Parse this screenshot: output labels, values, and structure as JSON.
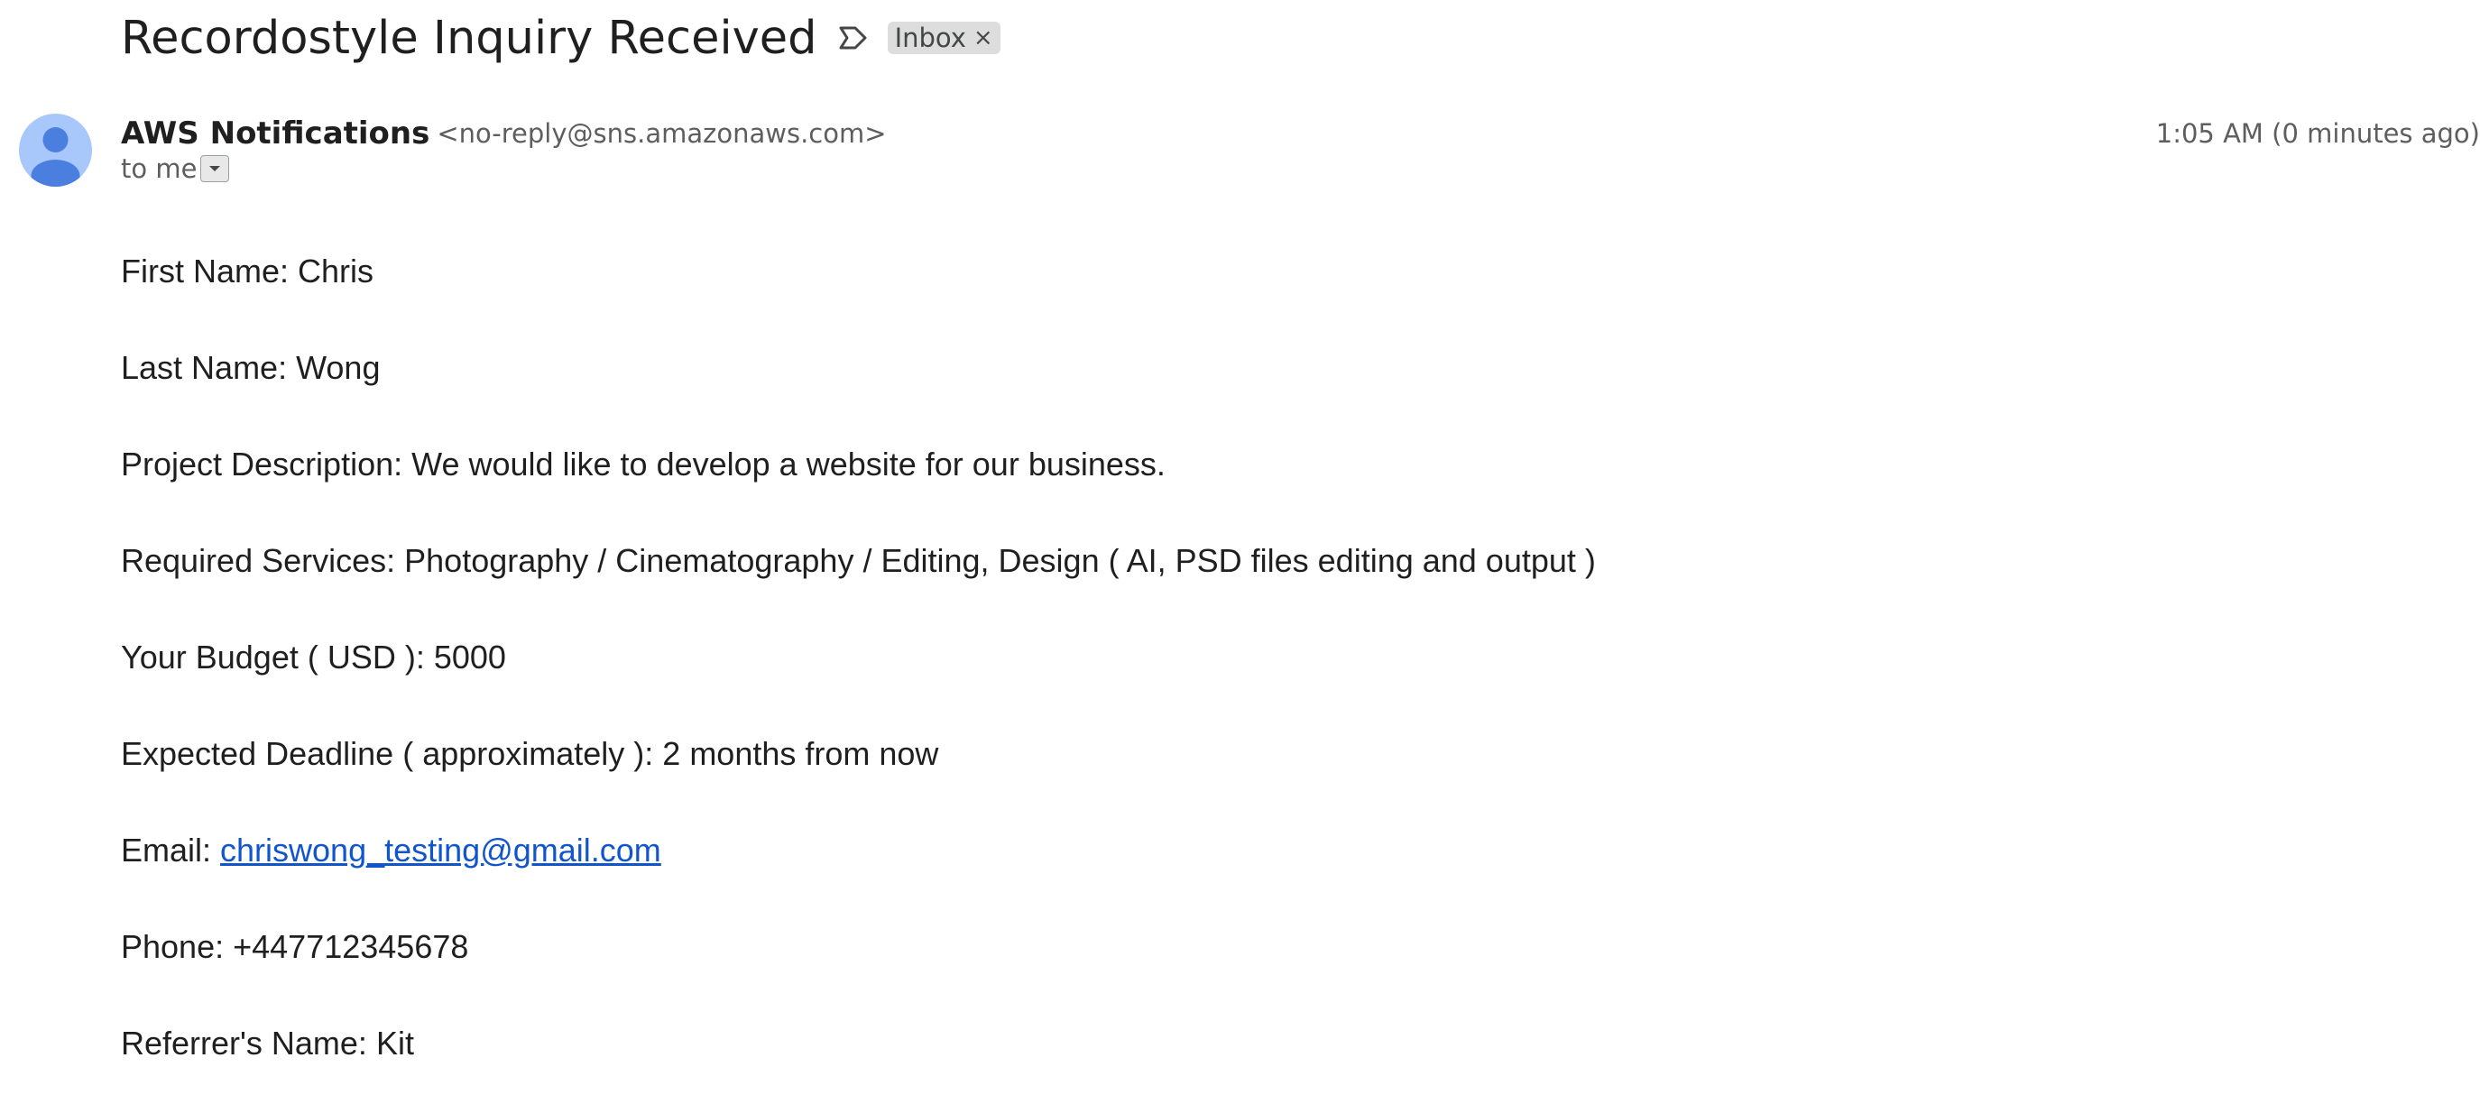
{
  "message": {
    "subject": "Recordostyle Inquiry Received",
    "label_chip": "Inbox",
    "label_chip_close": "×",
    "sender": {
      "name": "AWS Notifications",
      "email": "<no-reply@sns.amazonaws.com>"
    },
    "timestamp": "1:05 AM (0 minutes ago)",
    "recipient": "to me",
    "body": {
      "first_name": "First Name: Chris",
      "last_name": "Last Name: Wong",
      "project_description": "Project Description: We would like to develop a website for our business.",
      "required_services": "Required Services: Photography / Cinematography / Editing, Design ( AI, PSD files editing and output )",
      "budget": "Your Budget ( USD ): 5000",
      "deadline": "Expected Deadline ( approximately ): 2 months from now",
      "email_label": "Email: ",
      "email_link": "chriswong_testing@gmail.com",
      "phone": "Phone: +447712345678",
      "referrer": "Referrer's Name: Kit"
    }
  },
  "icons": {
    "important_marker": "label-important-outline-icon",
    "avatar": "default-user-avatar-icon",
    "details_toggle": "dropdown-arrow-icon"
  },
  "colors": {
    "avatar_background": "#a8c7fa",
    "avatar_figure": "#4a7fe0",
    "chip_background": "#dddddd",
    "link": "#1155cc"
  }
}
